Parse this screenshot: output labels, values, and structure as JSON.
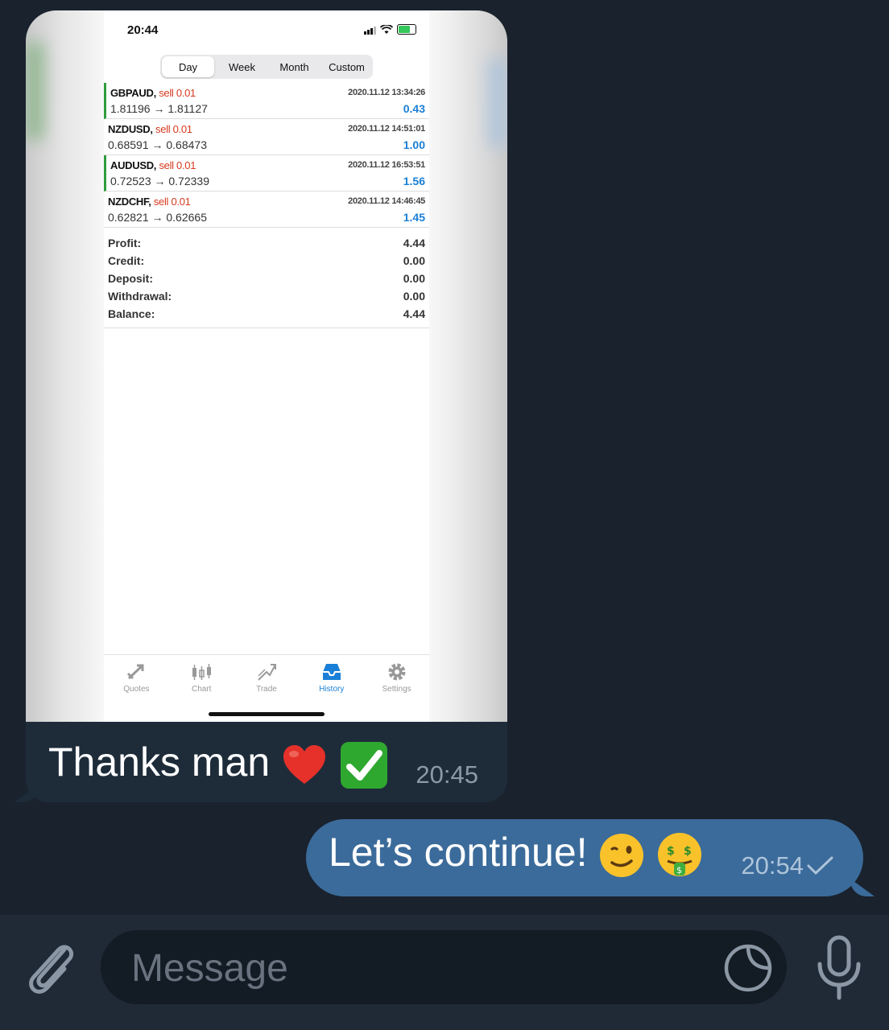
{
  "incoming": {
    "screenshot": {
      "status_time": "20:44",
      "tabs": [
        "Day",
        "Week",
        "Month",
        "Custom"
      ],
      "active_tab": "Day",
      "trades": [
        {
          "symbol": "GBPAUD,",
          "side": "sell 0.01",
          "time": "2020.11.12 13:34:26",
          "prices": "1.81196 → 1.81127",
          "pnl": "0.43",
          "marked": true
        },
        {
          "symbol": "NZDUSD,",
          "side": "sell 0.01",
          "time": "2020.11.12 14:51:01",
          "prices": "0.68591 → 0.68473",
          "pnl": "1.00",
          "marked": false
        },
        {
          "symbol": "AUDUSD,",
          "side": "sell 0.01",
          "time": "2020.11.12 16:53:51",
          "prices": "0.72523 → 0.72339",
          "pnl": "1.56",
          "marked": true
        },
        {
          "symbol": "NZDCHF,",
          "side": "sell 0.01",
          "time": "2020.11.12 14:46:45",
          "prices": "0.62821 → 0.62665",
          "pnl": "1.45",
          "marked": false
        }
      ],
      "summary": [
        {
          "label": "Profit:",
          "value": "4.44"
        },
        {
          "label": "Credit:",
          "value": "0.00"
        },
        {
          "label": "Deposit:",
          "value": "0.00"
        },
        {
          "label": "Withdrawal:",
          "value": "0.00"
        },
        {
          "label": "Balance:",
          "value": "4.44"
        }
      ],
      "bottom_tabs": [
        {
          "label": "Quotes",
          "icon": "quotes-icon"
        },
        {
          "label": "Chart",
          "icon": "chart-icon"
        },
        {
          "label": "Trade",
          "icon": "trade-icon"
        },
        {
          "label": "History",
          "icon": "history-icon"
        },
        {
          "label": "Settings",
          "icon": "gear-icon"
        }
      ],
      "active_bottom_tab": "History"
    },
    "text": "Thanks man",
    "emojis": [
      "heart-emoji",
      "check-mark-emoji"
    ],
    "time": "20:45"
  },
  "outgoing": {
    "text": "Let’s continue!",
    "emojis": [
      "winking-face-emoji",
      "money-mouth-face-emoji"
    ],
    "time": "20:54",
    "status_icon": "single-check-icon"
  },
  "composer": {
    "placeholder": "Message",
    "attach_icon": "paperclip-icon",
    "sticker_icon": "sticker-icon",
    "mic_icon": "microphone-icon"
  },
  "colors": {
    "background": "#1a222d",
    "incoming_bubble": "#1e2c3a",
    "outgoing_bubble": "#3b6b9a",
    "sell": "#d63a1f",
    "profit": "#1a7fd6"
  }
}
